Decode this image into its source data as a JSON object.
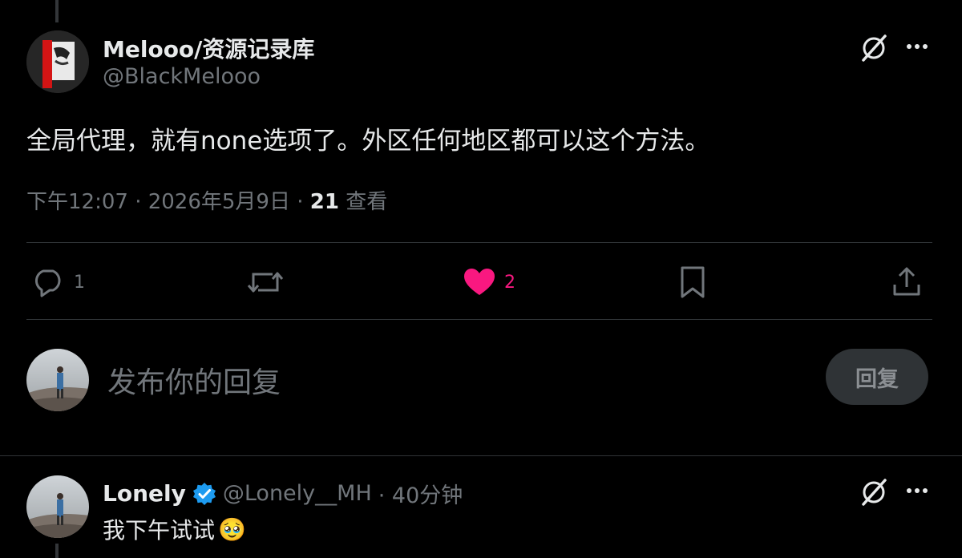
{
  "post": {
    "author_name": "Melooo/资源记录库",
    "author_handle": "@BlackMelooo",
    "text": "全局代理，就有none选项了。外区任何地区都可以这个方法。",
    "time": "下午12:07 · 2026年5月9日 · ",
    "views_count": "21",
    "views_label": "查看",
    "actions": {
      "reply_count": "1",
      "repost_count": "",
      "like_count": "2",
      "like_color": "#f91880"
    },
    "icons": {
      "grok": "grok-slash-icon",
      "more": "more-dots-icon",
      "reply": "reply-bubble-icon",
      "repost": "repost-arrows-icon",
      "like": "heart-filled-icon",
      "bookmark": "bookmark-icon",
      "share": "share-upload-icon"
    }
  },
  "composer": {
    "placeholder": "发布你的回复",
    "reply_button": "回复"
  },
  "reply": {
    "author_name": "Lonely",
    "verified": true,
    "author_handle": "@Lonely__MH",
    "time": "· 40分钟",
    "text": "我下午试试",
    "emoji": "🥹"
  },
  "colors": {
    "background": "#000000",
    "text": "#e7e9ea",
    "secondary": "#71767b",
    "divider": "#2f3336",
    "verified": "#1d9bf0",
    "like": "#f91880"
  }
}
